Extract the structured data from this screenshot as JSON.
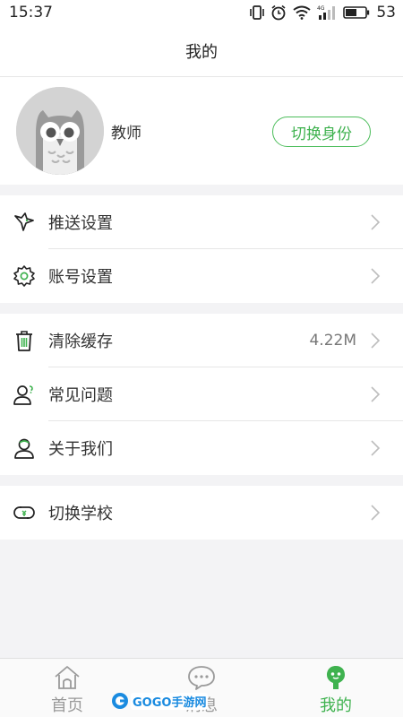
{
  "status_bar": {
    "time": "15:37",
    "battery": "53"
  },
  "header": {
    "title": "我的"
  },
  "profile": {
    "role": "教师",
    "switch_label": "切换身份"
  },
  "menu": {
    "push_settings": "推送设置",
    "account_settings": "账号设置",
    "clear_cache": "清除缓存",
    "cache_size": "4.22M",
    "faq": "常见问题",
    "about_us": "关于我们",
    "switch_school": "切换学校"
  },
  "tabs": {
    "home": "首页",
    "messages": "消息",
    "mine": "我的"
  },
  "watermark": {
    "text": "GOGO手游网"
  },
  "colors": {
    "accent": "#3fb24f",
    "background": "#f3f3f5"
  }
}
